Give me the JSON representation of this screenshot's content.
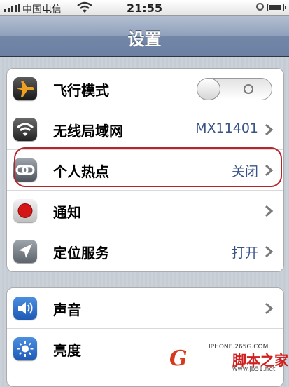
{
  "status_bar": {
    "carrier": "中国电信",
    "time": "21:55"
  },
  "nav": {
    "title": "设置"
  },
  "group1": [
    {
      "label": "飞行模式",
      "icon": "airplane-icon",
      "control": "toggle",
      "toggle_on": false
    },
    {
      "label": "无线局域网",
      "icon": "wifi-icon",
      "value": "MX11401"
    },
    {
      "label": "个人热点",
      "icon": "hotspot-link-icon",
      "value": "关闭",
      "highlighted": true
    },
    {
      "label": "通知",
      "icon": "notification-icon",
      "value": ""
    },
    {
      "label": "定位服务",
      "icon": "location-arrow-icon",
      "value": "打开"
    }
  ],
  "group2": [
    {
      "label": "声音",
      "icon": "speaker-icon",
      "value": ""
    },
    {
      "label": "亮度",
      "icon": "brightness-icon",
      "value": ""
    }
  ],
  "watermark": {
    "site_text": "IPHONE.265G.COM",
    "name": "脚本之家",
    "url": "www.jb51.net"
  },
  "colors": {
    "highlight": "#b5252b",
    "value_text": "#385487",
    "nav_bar": "#6b80a3"
  }
}
